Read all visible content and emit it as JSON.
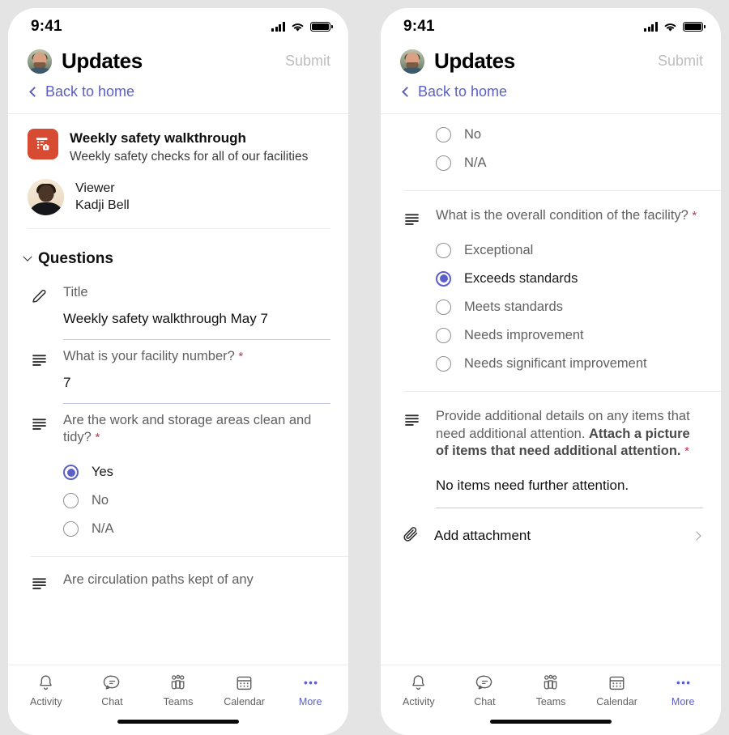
{
  "statusbar": {
    "time": "9:41",
    "signal_icon": "cellular-bars-icon",
    "wifi_icon": "wifi-icon",
    "battery_icon": "battery-icon"
  },
  "header": {
    "avatar": "user-avatar",
    "title": "Updates",
    "submit_label": "Submit",
    "back_label": "Back to home",
    "accent_color": "#5b5fc7",
    "submit_color": "#bdbdbd"
  },
  "form": {
    "icon": "forms-app-icon",
    "icon_color": "#d64b32",
    "title": "Weekly safety walkthrough",
    "subtitle": "Weekly safety checks for all of our facilities",
    "viewer_role": "Viewer",
    "viewer_name": "Kadji Bell",
    "section_label": "Questions",
    "required_marker": "*"
  },
  "left_screen": {
    "questions": [
      {
        "icon": "pencil-icon",
        "label": "Title",
        "required": false,
        "type": "text",
        "answer": "Weekly safety walkthrough May 7"
      },
      {
        "icon": "text-lines-icon",
        "label": "What is your facility number?",
        "required": true,
        "type": "text",
        "answer": "7"
      },
      {
        "icon": "text-lines-icon",
        "label": "Are the work and storage areas clean and tidy?",
        "required": true,
        "type": "radio",
        "options": [
          "Yes",
          "No",
          "N/A"
        ],
        "selected": "Yes"
      },
      {
        "icon": "text-lines-icon",
        "label": "Are circulation paths kept of any",
        "required": false,
        "type": "truncated"
      }
    ]
  },
  "right_screen": {
    "partial_options_top": [
      "No",
      "N/A"
    ],
    "questions": [
      {
        "icon": "text-lines-icon",
        "label": "What is the overall condition of the facility?",
        "required": true,
        "type": "radio",
        "options": [
          "Exceptional",
          "Exceeds standards",
          "Meets standards",
          "Needs improvement",
          "Needs significant improvement"
        ],
        "selected": "Exceeds standards"
      },
      {
        "icon": "text-lines-icon",
        "label_plain": "Provide additional details on any items that need additional attention. ",
        "label_bold": "Attach a picture of items that need additional attention.",
        "required": true,
        "type": "text",
        "answer": "No items need further attention."
      }
    ],
    "attachment": {
      "icon": "paperclip-icon",
      "label": "Add attachment",
      "chevron": "chevron-right-icon"
    }
  },
  "tabbar": {
    "items": [
      {
        "icon": "bell-icon",
        "label": "Activity",
        "active": false
      },
      {
        "icon": "chat-icon",
        "label": "Chat",
        "active": false
      },
      {
        "icon": "teams-icon",
        "label": "Teams",
        "active": false
      },
      {
        "icon": "calendar-icon",
        "label": "Calendar",
        "active": false
      },
      {
        "icon": "more-dots-icon",
        "label": "More",
        "active": true
      }
    ]
  }
}
